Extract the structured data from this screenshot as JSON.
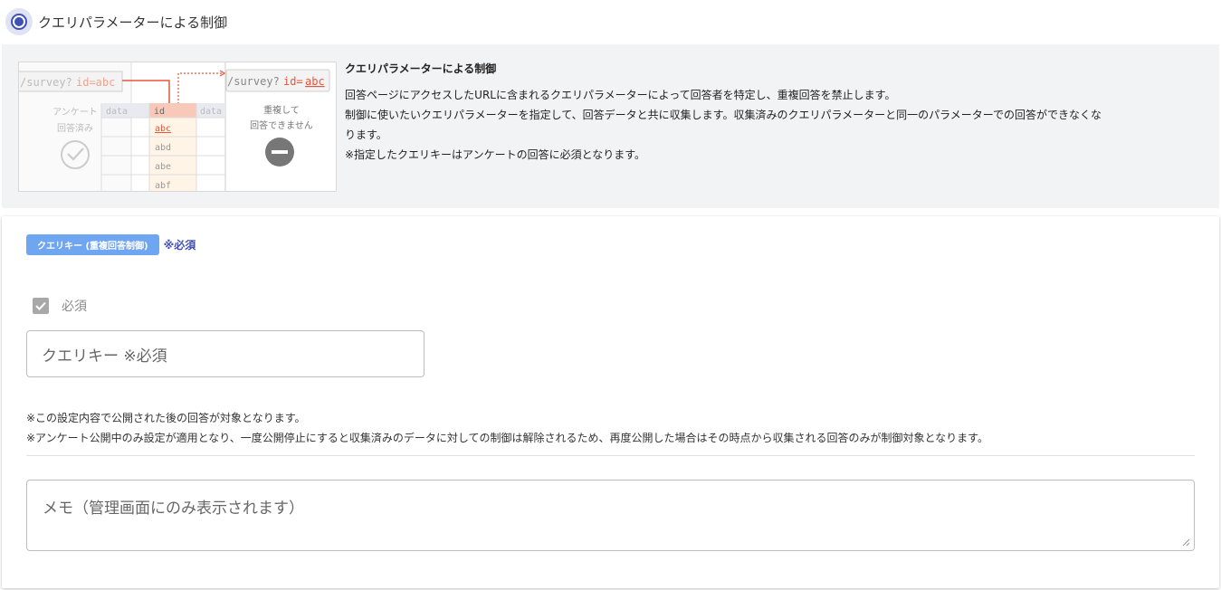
{
  "option": {
    "label": "クエリパラメーターによる制御",
    "selected": true
  },
  "illustration": {
    "url_left_path": "/survey?",
    "url_left_query": "id=abc",
    "url_right_path": "/survey?",
    "url_right_id": "id=",
    "url_right_value": "abc",
    "left_caption_1": "アンケート",
    "left_caption_2": "回答済み",
    "col_data_1": "data",
    "col_id": "id",
    "col_data_2": "data",
    "rows": [
      "abc",
      "abd",
      "abe",
      "abf"
    ],
    "blocked_caption_1": "重複して",
    "blocked_caption_2": "回答できません"
  },
  "info": {
    "title": "クエリパラメーターによる制御",
    "line1": "回答ページにアクセスしたURLに含まれるクエリパラメーターによって回答者を特定し、重複回答を禁止します。",
    "line2": "制御に使いたいクエリパラメーターを指定して、回答データと共に収集します。収集済みのクエリパラメーターと同一のパラメーターでの回答ができなくな",
    "line3": "ります。",
    "line4": "※指定したクエリキーはアンケートの回答に必須となります。"
  },
  "form": {
    "tag_label": "クエリキー (重複回答制御)",
    "required_mark": "※必須",
    "checkbox_label": "必須",
    "checkbox_checked": true,
    "query_key_placeholder": "クエリキー ※必須",
    "note1": "※この設定内容で公開された後の回答が対象となります。",
    "note2": "※アンケート公開中のみ設定が適用となり、一度公開停止にすると収集済みのデータに対しての制御は解除されるため、再度公開した場合はその時点から収集される回答のみが制御対象となります。",
    "memo_placeholder": "メモ（管理画面にのみ表示されます）"
  },
  "colors": {
    "accent": "#3f51b5",
    "tag_bg": "#6fa6f2",
    "highlight_red": "#e8553a"
  }
}
